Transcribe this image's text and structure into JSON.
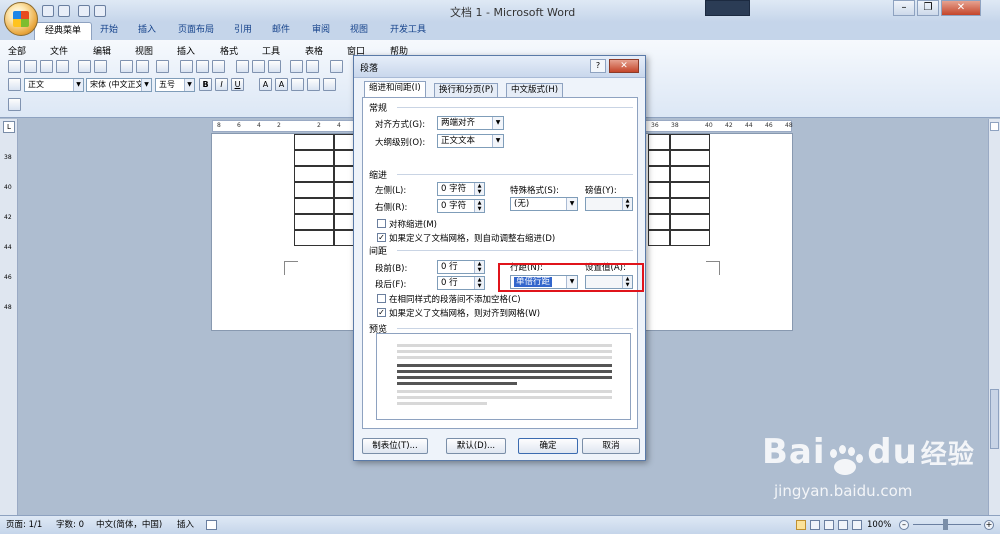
{
  "window": {
    "title": "文档 1 - Microsoft Word"
  },
  "ribbon_tabs": [
    "经典菜单",
    "开始",
    "插入",
    "页面布局",
    "引用",
    "邮件",
    "审阅",
    "视图",
    "开发工具"
  ],
  "classic_menu": [
    "全部",
    "文件",
    "编辑",
    "视图",
    "插入",
    "格式",
    "工具",
    "表格",
    "窗口",
    "帮助"
  ],
  "toolbar": {
    "style_value": "正文",
    "font_value": "宋体 (中文正文)",
    "size_value": "五号"
  },
  "status": {
    "page": "页面: 1/1",
    "words": "字数: 0",
    "language": "中文(简体，中国)",
    "mode": "插入",
    "zoom": "100%"
  },
  "ruler_labels": [
    "8",
    "6",
    "4",
    "2",
    "2",
    "4",
    "36",
    "38",
    "40",
    "42",
    "44",
    "46",
    "48"
  ],
  "vruler_labels": [
    "38",
    "40",
    "42",
    "44",
    "46",
    "48"
  ],
  "dialog": {
    "title": "段落",
    "help": "?",
    "close": "✕",
    "tabs": [
      "缩进和间距(I)",
      "换行和分页(P)",
      "中文版式(H)"
    ],
    "general": {
      "heading": "常规",
      "align_label": "对齐方式(G):",
      "align_value": "两端对齐",
      "outline_label": "大纲级别(O):",
      "outline_value": "正文文本"
    },
    "indent": {
      "heading": "缩进",
      "left_label": "左侧(L):",
      "left_value": "0 字符",
      "right_label": "右侧(R):",
      "right_value": "0 字符",
      "special_label": "特殊格式(S):",
      "special_value": "(无)",
      "by_label": "磅值(Y):",
      "mirror_label": "对称缩进(M)",
      "auto_label": "如果定义了文档网格，则自动调整右缩进(D)"
    },
    "spacing": {
      "heading": "间距",
      "before_label": "段前(B):",
      "before_value": "0 行",
      "after_label": "段后(F):",
      "after_value": "0 行",
      "line_label": "行距(N):",
      "line_value": "单倍行距",
      "at_label": "设置值(A):",
      "no_space_label": "在相同样式的段落间不添加空格(C)",
      "snap_label": "如果定义了文档网格，则对齐到网格(W)"
    },
    "preview_heading": "预览",
    "buttons": {
      "tabs": "制表位(T)...",
      "default": "默认(D)...",
      "ok": "确定",
      "cancel": "取消"
    }
  },
  "watermark": {
    "brand_a": "Bai",
    "brand_b": "du",
    "brand_cn": "经验",
    "url": "jingyan.baidu.com"
  }
}
